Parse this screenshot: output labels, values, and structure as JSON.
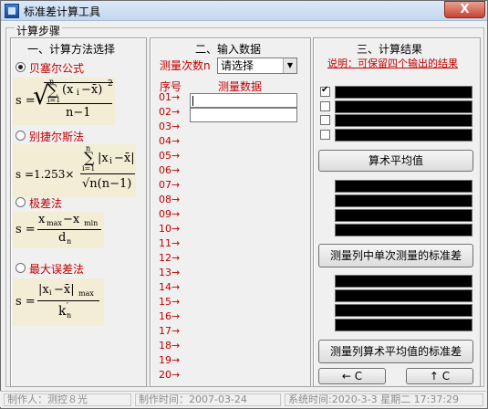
{
  "window": {
    "title": "标准差计算工具",
    "close_label": "X"
  },
  "group_title": "计算步骤",
  "section1": {
    "title": "一、计算方法选择",
    "methods": [
      {
        "label": "贝塞尔公式",
        "selected": true
      },
      {
        "label": "别捷尔斯法",
        "selected": false
      },
      {
        "label": "极差法",
        "selected": false
      },
      {
        "label": "最大误差法",
        "selected": false
      }
    ],
    "formula_bessel": {
      "lhs": "s =",
      "num": "(x",
      "num_sub": "i",
      "num_rest": "−x̄)",
      "sup": "2",
      "sum_top": "n",
      "sum_bottom": "i=1",
      "den": "n−1"
    },
    "formula_peters": {
      "lhs": "s =1.253×",
      "num": "|x",
      "num_sub": "i",
      "num_rest": "−x̄|",
      "sum_top": "n",
      "sum_bottom": "i=1",
      "den": "√n(n−1)"
    },
    "formula_range": {
      "lhs": "s =",
      "num": "x",
      "num_sub1": "max",
      "num_mid": "−x",
      "num_sub2": "min",
      "den": "d",
      "den_sub": "n"
    },
    "formula_maxerr": {
      "lhs": "s =",
      "num": "|x",
      "num_sub": "i",
      "num_rest": "−x̄|",
      "num_sub2": "max",
      "den": "k",
      "den_sub": "n",
      "den_sup": "′"
    }
  },
  "section2": {
    "title": "二、输入数据",
    "count_label": "测量次数n",
    "count_select": "请选择",
    "col_index": "序号",
    "col_data": "测量数据",
    "rows": [
      "01→",
      "02→",
      "03→",
      "04→",
      "05→",
      "06→",
      "07→",
      "08→",
      "09→",
      "10→",
      "11→",
      "12→",
      "13→",
      "14→",
      "15→",
      "16→",
      "17→",
      "18→",
      "19→",
      "20→"
    ],
    "values": [
      "",
      ""
    ]
  },
  "section3": {
    "title": "三、计算结果",
    "note": "说明：可保留四个输出的结果",
    "checkboxes": [
      true,
      false,
      false,
      false
    ],
    "btn_mean": "算术平均值",
    "btn_single_sd": "测量列中单次测量的标准差",
    "btn_mean_sd": "测量列算术平均值的标准差",
    "btn_back": "← C",
    "btn_up": "↑ C"
  },
  "status": {
    "author": "制作人：测控８光",
    "made_time": "制作时间：2007-03-24",
    "sys_time": "系统时间:2020-3-3  星期二  17:37:29"
  }
}
